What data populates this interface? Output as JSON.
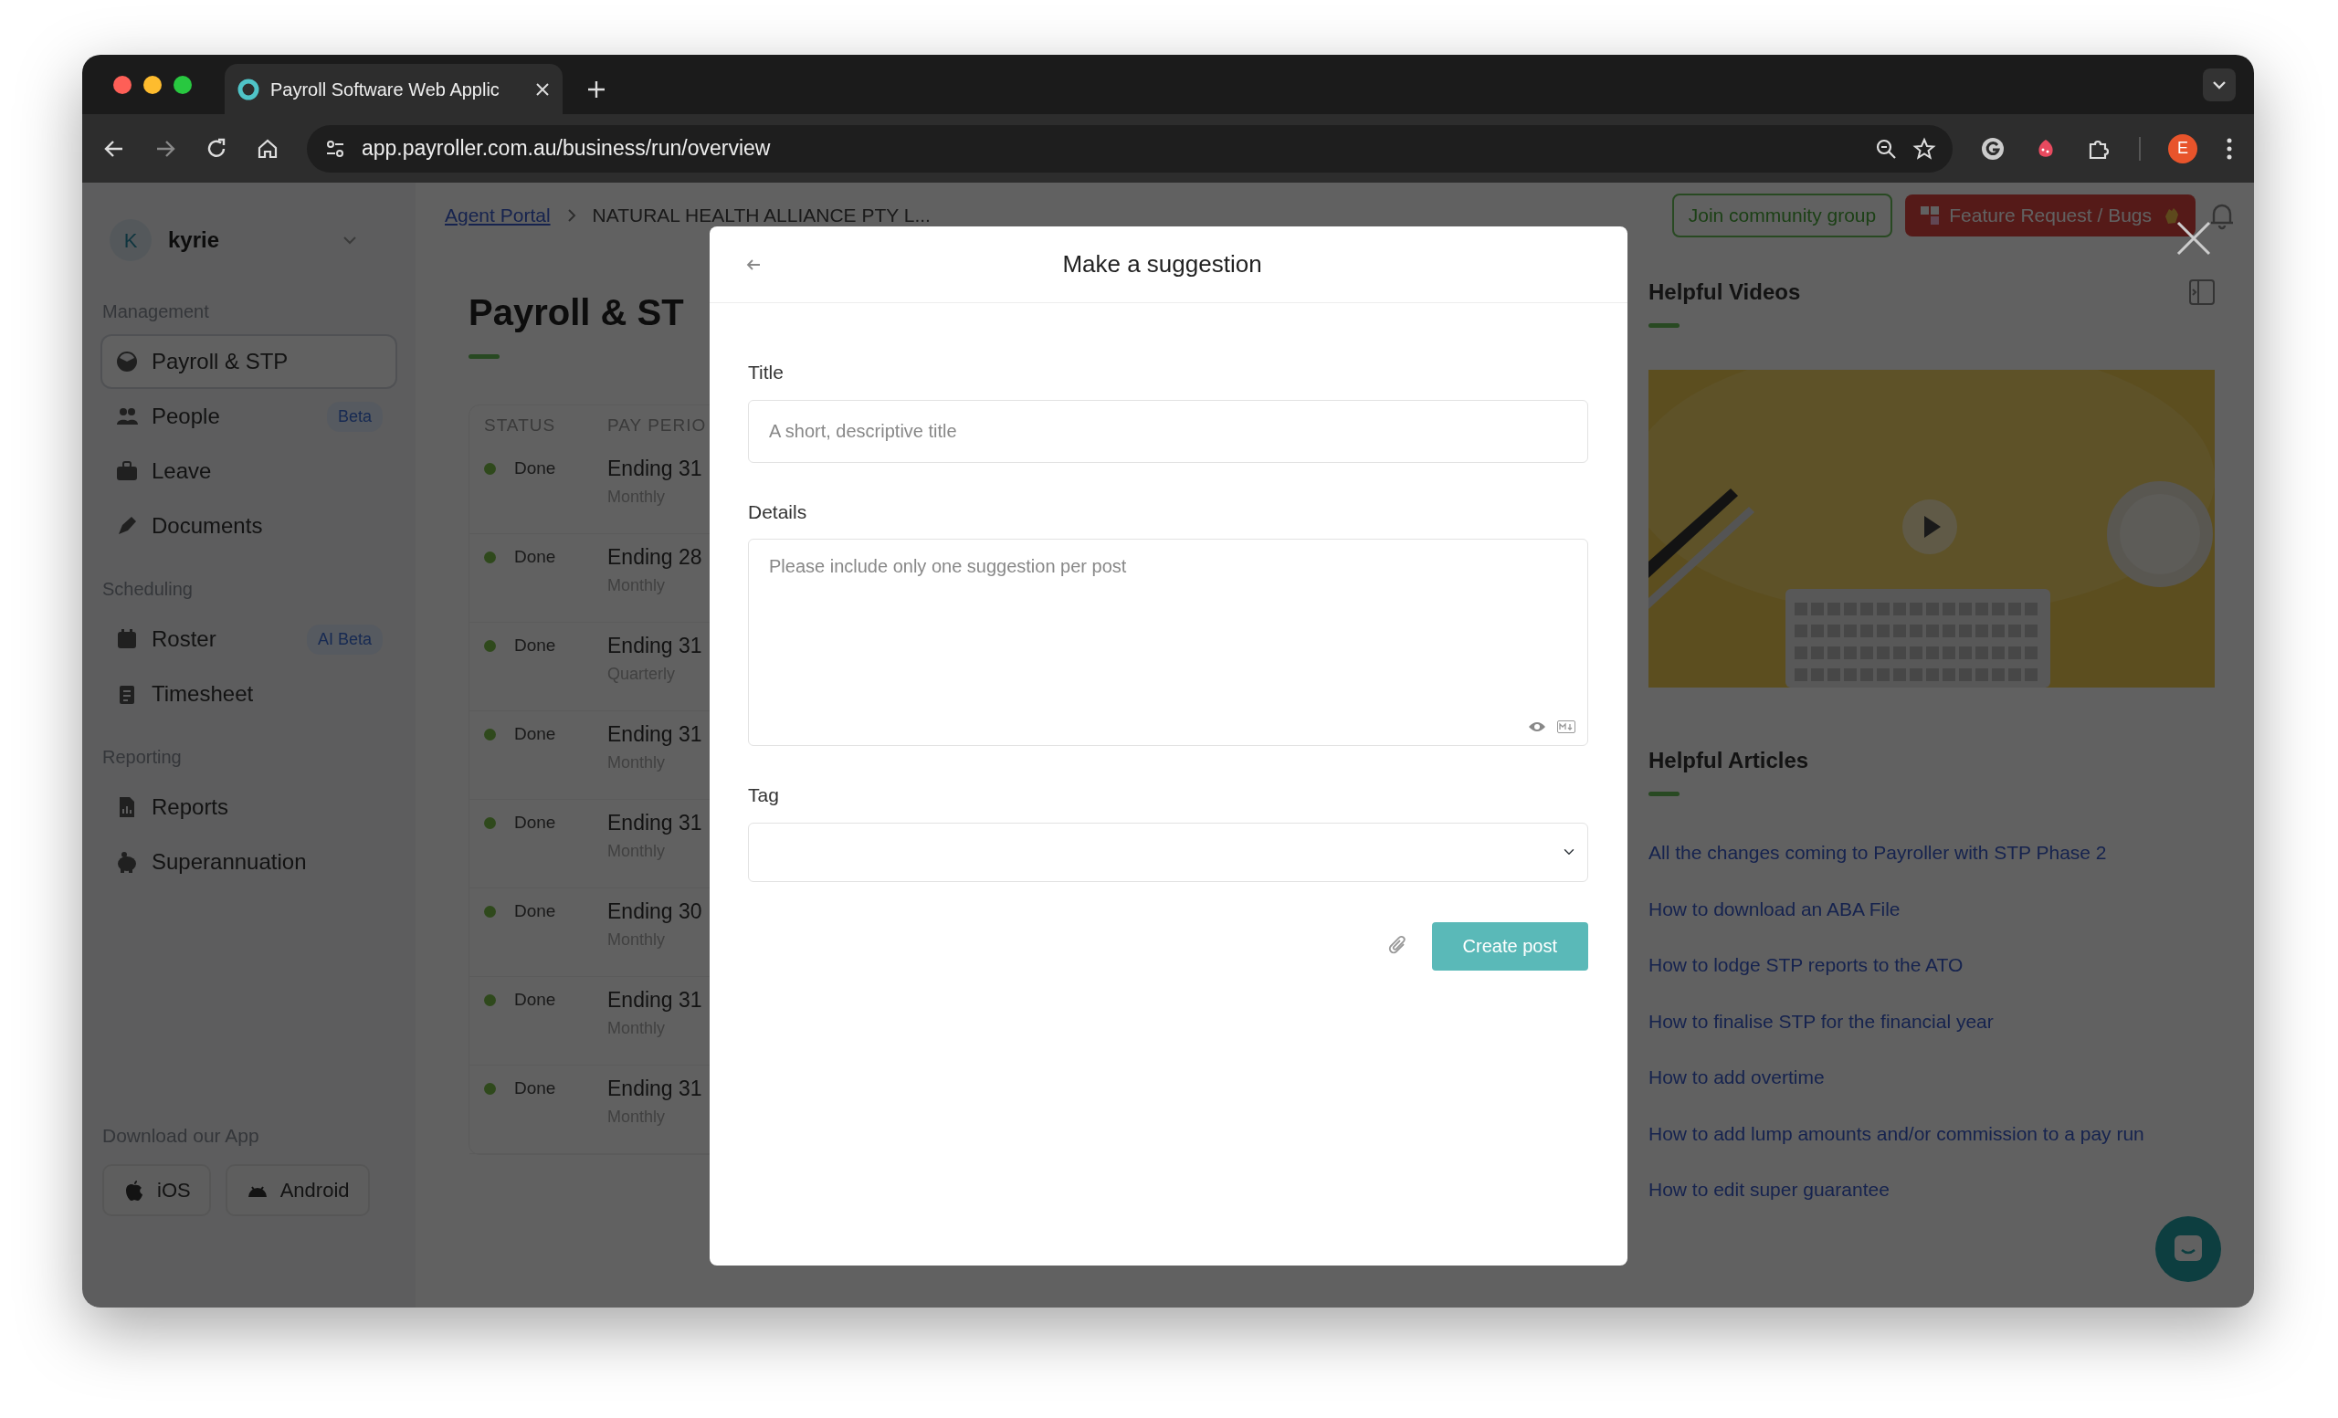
{
  "browser": {
    "tabs": [
      {
        "title": "Payroll Software Web Applic",
        "selected": true
      }
    ],
    "url": "app.payroller.com.au/business/run/overview",
    "profile_initial": "E"
  },
  "sidebar": {
    "account": {
      "initial": "K",
      "name": "kyrie"
    },
    "sections": [
      {
        "label": "Management",
        "items": [
          {
            "label": "Payroll & STP",
            "selected": true
          },
          {
            "label": "People",
            "selected": false,
            "badge": "Beta"
          },
          {
            "label": "Leave",
            "selected": false
          },
          {
            "label": "Documents",
            "selected": false
          }
        ]
      },
      {
        "label": "Scheduling",
        "items": [
          {
            "label": "Roster",
            "selected": false,
            "badge": "AI Beta"
          },
          {
            "label": "Timesheet",
            "selected": false
          }
        ]
      },
      {
        "label": "Reporting",
        "items": [
          {
            "label": "Reports",
            "selected": false
          },
          {
            "label": "Superannuation",
            "selected": false
          }
        ]
      }
    ],
    "download": {
      "label": "Download our App",
      "apps": [
        "iOS",
        "Android"
      ]
    }
  },
  "main": {
    "breadcrumb": [
      "Agent Portal",
      "NATURAL HEALTH ALLIANCE PTY L..."
    ],
    "heading": "Payroll & ST",
    "columns": [
      "STATUS",
      "PAY PERIO"
    ],
    "rows": [
      {
        "status": "Done",
        "period": "Ending 31",
        "frequency": "Monthly"
      },
      {
        "status": "Done",
        "period": "Ending 28",
        "frequency": "Monthly"
      },
      {
        "status": "Done",
        "period": "Ending 31",
        "frequency": "Quarterly"
      },
      {
        "status": "Done",
        "period": "Ending 31",
        "frequency": "Monthly"
      },
      {
        "status": "Done",
        "period": "Ending 31",
        "frequency": "Monthly"
      },
      {
        "status": "Done",
        "period": "Ending 30",
        "frequency": "Monthly"
      },
      {
        "status": "Done",
        "period": "Ending 31",
        "frequency": "Monthly"
      },
      {
        "status": "Done",
        "period": "Ending 31",
        "frequency": "Monthly"
      }
    ]
  },
  "header_actions": {
    "community": "Join community group",
    "feature": "Feature Request / Bugs"
  },
  "help_panel": {
    "videos_title": "Helpful Videos",
    "video": {
      "kind": "picture"
    },
    "articles_title": "Helpful Articles",
    "articles": [
      "All the changes coming to Payroller with STP Phase 2",
      "How to download an ABA File",
      "How to lodge STP reports to the ATO",
      "How to finalise STP for the financial year",
      "How to add overtime",
      "How to add lump amounts and/or commission to a pay run",
      "How to edit super guarantee"
    ]
  },
  "modal": {
    "title": "Make a suggestion",
    "fields": [
      {
        "label": "Title",
        "kind": "input",
        "placeholder": "A short, descriptive title"
      },
      {
        "label": "Details",
        "kind": "textarea",
        "placeholder": "Please include only one suggestion per post"
      },
      {
        "label": "Tag",
        "kind": "select"
      }
    ],
    "submit": "Create post"
  }
}
